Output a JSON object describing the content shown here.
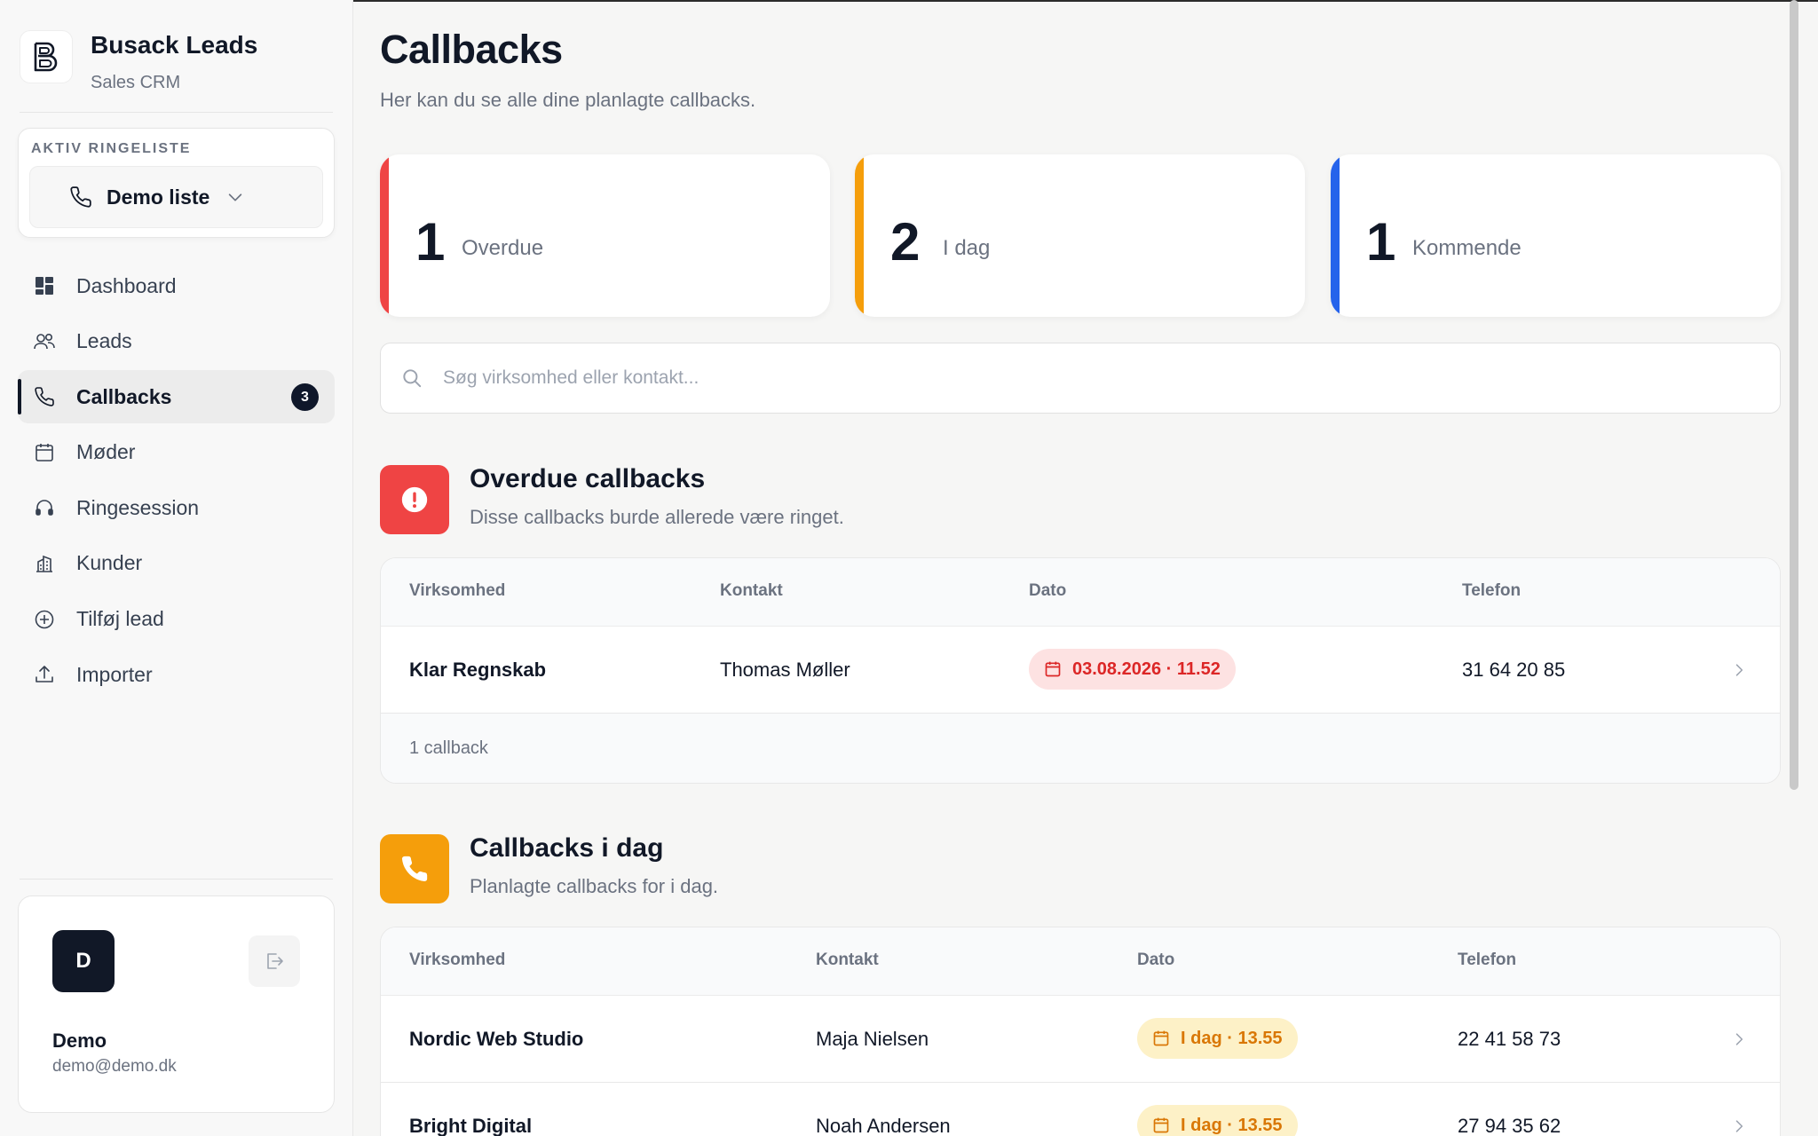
{
  "brand": {
    "title": "Busack Leads",
    "subtitle": "Sales CRM"
  },
  "active_list": {
    "label": "AKTIV RINGELISTE",
    "name": "Demo liste"
  },
  "nav": [
    {
      "label": "Dashboard",
      "icon": "dashboard-icon"
    },
    {
      "label": "Leads",
      "icon": "users-icon"
    },
    {
      "label": "Callbacks",
      "icon": "phone-icon",
      "badge": "3",
      "active": true
    },
    {
      "label": "Møder",
      "icon": "calendar-icon"
    },
    {
      "label": "Ringesession",
      "icon": "headset-icon"
    },
    {
      "label": "Kunder",
      "icon": "building-icon"
    },
    {
      "label": "Tilføj lead",
      "icon": "plus-circle-icon"
    },
    {
      "label": "Importer",
      "icon": "upload-icon"
    }
  ],
  "user": {
    "initial": "D",
    "name": "Demo",
    "email": "demo@demo.dk"
  },
  "page": {
    "title": "Callbacks",
    "subtitle": "Her kan du se alle dine planlagte callbacks."
  },
  "stats": [
    {
      "value": "1",
      "label": "Overdue",
      "color": "#ef4444"
    },
    {
      "value": "2",
      "label": "I dag",
      "color": "#f59e0b"
    },
    {
      "value": "1",
      "label": "Kommende",
      "color": "#2563eb"
    }
  ],
  "search": {
    "placeholder": "Søg virksomhed eller kontakt..."
  },
  "overdue": {
    "title": "Overdue callbacks",
    "subtitle": "Disse callbacks burde allerede være ringet.",
    "color": "#ef4444",
    "columns": [
      "Virksomhed",
      "Kontakt",
      "Dato",
      "Telefon"
    ],
    "rows": [
      {
        "company": "Klar Regnskab",
        "contact": "Thomas Møller",
        "date": "03.08.2026 · 11.52",
        "phone": "31 64 20 85"
      }
    ],
    "footer": "1 callback"
  },
  "today": {
    "title": "Callbacks i dag",
    "subtitle": "Planlagte callbacks for i dag.",
    "color": "#f59e0b",
    "columns": [
      "Virksomhed",
      "Kontakt",
      "Dato",
      "Telefon"
    ],
    "rows": [
      {
        "company": "Nordic Web Studio",
        "contact": "Maja Nielsen",
        "date": "I dag · 13.55",
        "phone": "22 41 58 73"
      },
      {
        "company": "Bright Digital",
        "contact": "Noah Andersen",
        "date": "I dag · 13.55",
        "phone": "27 94 35 62"
      }
    ]
  }
}
